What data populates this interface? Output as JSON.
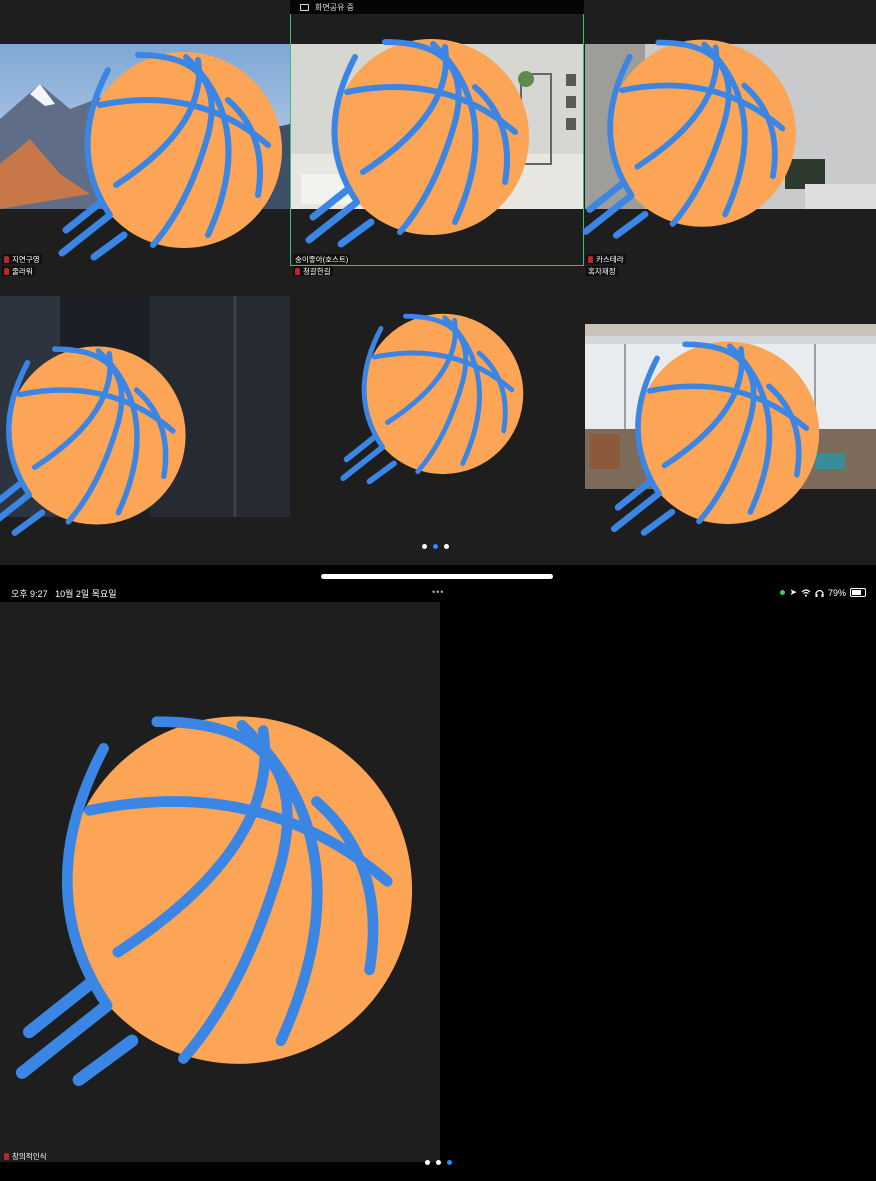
{
  "share_banner": {
    "text": "화면공유 중"
  },
  "participants": [
    {
      "name": "지연구영",
      "sub": "줄라워",
      "muted": true
    },
    {
      "name": "송이좋아(호스트)",
      "sub": "청갈한길",
      "muted": false,
      "host": true
    },
    {
      "name": "카스테라",
      "sub": "혹자재정",
      "muted": true
    },
    {
      "name": "",
      "sub": ""
    },
    {
      "name": "",
      "sub": ""
    },
    {
      "name": "",
      "sub": ""
    }
  ],
  "top_page_dots": {
    "count": 3,
    "active": 1
  },
  "status_bar": {
    "time": "오후 9:27",
    "date": "10월 2일 목요일",
    "more": "•••",
    "battery": "79%"
  },
  "bottom": {
    "participant_name": "창의적인식",
    "page_dots": {
      "count": 3,
      "active": 2
    }
  },
  "colors": {
    "accent": "#2d8cff",
    "host_border": "#35c07a",
    "ball": "#fca556",
    "ball_lines": "#3b86e4"
  }
}
